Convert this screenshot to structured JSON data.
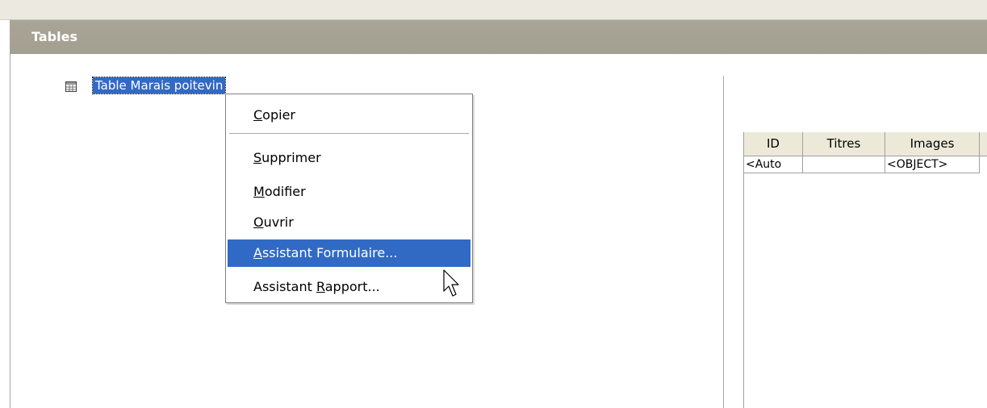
{
  "panel": {
    "title": "Tables"
  },
  "tree": {
    "items": [
      {
        "label": "Table Marais poitevin",
        "icon": "table-icon"
      }
    ]
  },
  "preview": {
    "columns": [
      "ID",
      "Titres",
      "Images"
    ],
    "rows": [
      [
        "<Auto",
        "",
        "<OBJECT>"
      ]
    ]
  },
  "context_menu": {
    "items": [
      {
        "mnemonic": "C",
        "rest": "opier"
      },
      {
        "mnemonic": "S",
        "rest": "upprimer"
      },
      {
        "mnemonic": "M",
        "rest": "odifier"
      },
      {
        "mnemonic": "O",
        "rest": "uvrir"
      },
      {
        "mnemonic": "A",
        "rest": "ssistant Formulaire..."
      },
      {
        "before": "Assistant ",
        "mnemonic": "R",
        "rest": "apport..."
      }
    ],
    "highlighted": "Assistant Formulaire..."
  },
  "colors": {
    "selection": "#316ac5",
    "header": "#a6a294",
    "grid_header": "#ece9d8"
  }
}
